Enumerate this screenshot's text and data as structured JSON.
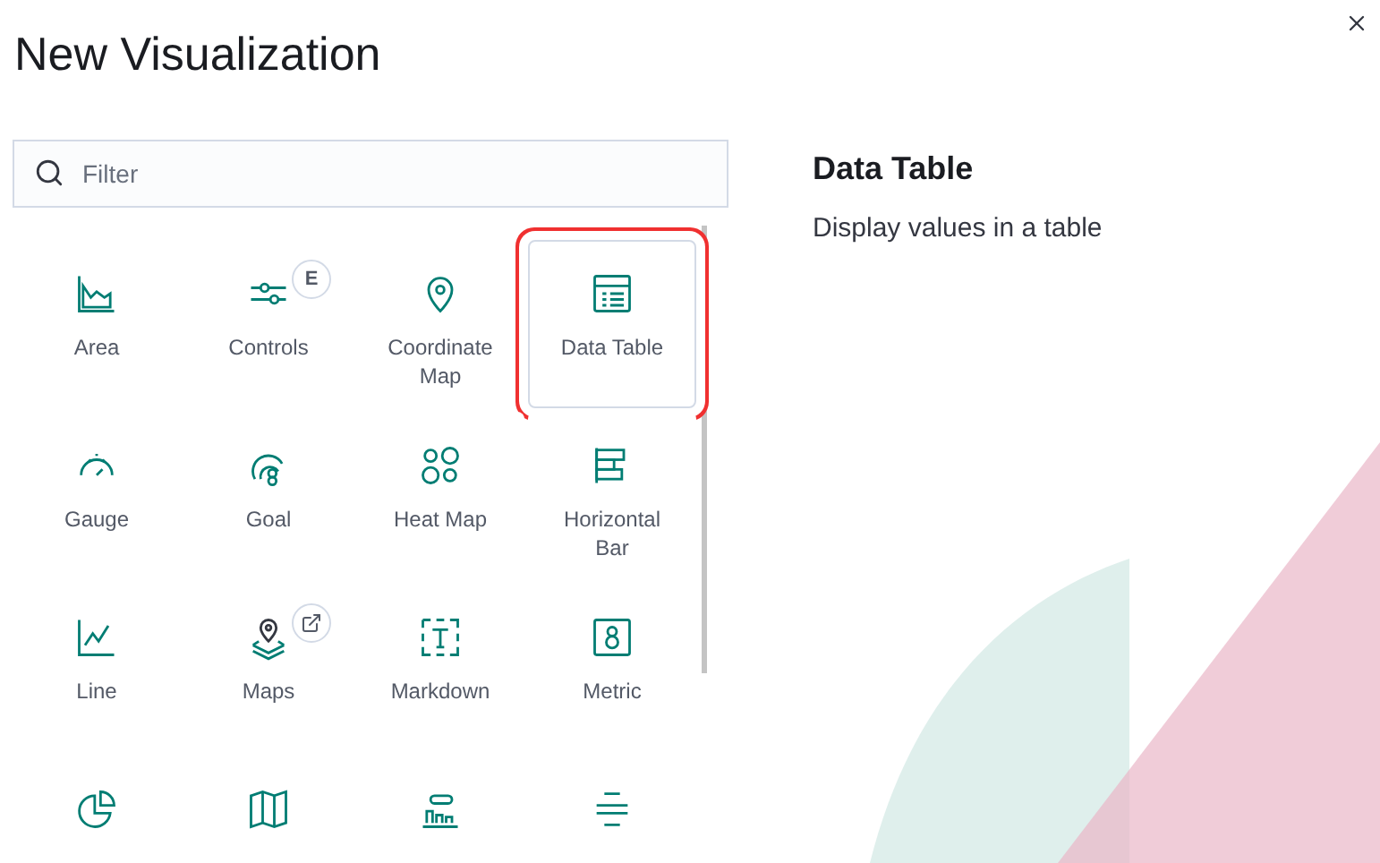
{
  "title": "New Visualization",
  "search": {
    "placeholder": "Filter"
  },
  "tiles": [
    {
      "label": "Area",
      "selected": false
    },
    {
      "label": "Controls",
      "selected": false,
      "badge": {
        "kind": "text",
        "text": "E"
      }
    },
    {
      "label": "Coordinate Map",
      "selected": false
    },
    {
      "label": "Data Table",
      "selected": true
    },
    {
      "label": "Gauge",
      "selected": false
    },
    {
      "label": "Goal",
      "selected": false
    },
    {
      "label": "Heat Map",
      "selected": false
    },
    {
      "label": "Horizontal Bar",
      "selected": false
    },
    {
      "label": "Line",
      "selected": false
    },
    {
      "label": "Maps",
      "selected": false,
      "badge": {
        "kind": "icon"
      }
    },
    {
      "label": "Markdown",
      "selected": false
    },
    {
      "label": "Metric",
      "selected": false
    },
    {
      "selected": false
    },
    {
      "selected": false
    },
    {
      "selected": false
    },
    {
      "selected": false
    }
  ],
  "preview": {
    "title": "Data Table",
    "description": "Display values in a table"
  }
}
